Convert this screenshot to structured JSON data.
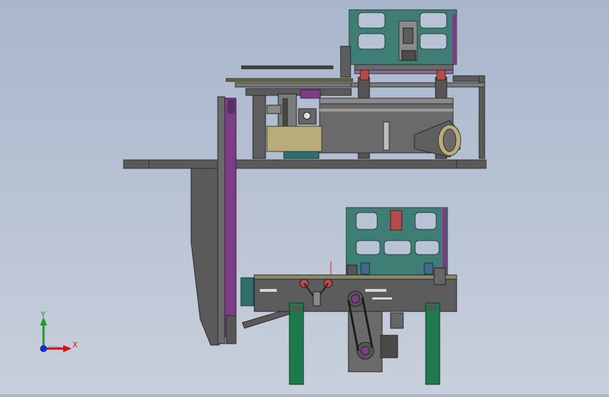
{
  "viewport": {
    "background_top": "#a9b6cc",
    "background_bottom": "#c9d0dc"
  },
  "colors": {
    "frame_dark": "#4a4a4a",
    "frame_mid": "#6e6e6e",
    "plate_green": "#3f7e74",
    "leg_green": "#1e7a4d",
    "belt_purple": "#7b3d86",
    "accent_red": "#b44b4b",
    "tan": "#b8ad7a"
  },
  "triad": {
    "x_label": "X",
    "y_label": "Y",
    "x_color": "#d11111",
    "y_color": "#1a9a2a",
    "z_color": "#1a2ad1"
  }
}
